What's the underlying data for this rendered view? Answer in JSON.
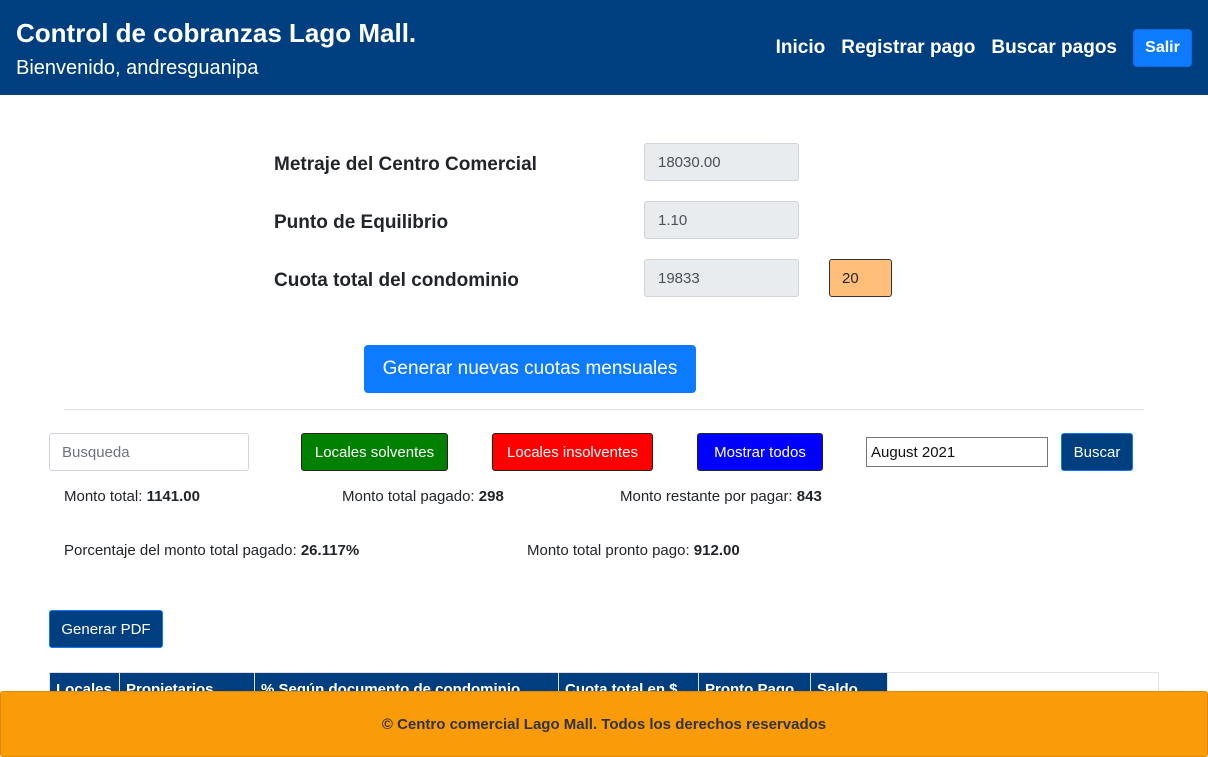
{
  "header": {
    "title": "Control de cobranzas Lago Mall.",
    "welcome": "Bienvenido, andresguanipa",
    "nav": {
      "inicio": "Inicio",
      "registrar": "Registrar pago",
      "buscar": "Buscar pagos",
      "salir": "Salir"
    }
  },
  "form": {
    "metraje": {
      "label": "Metraje del Centro Comercial",
      "value": "18030.00"
    },
    "equilibrio": {
      "label": "Punto de Equilibrio",
      "value": "1.10"
    },
    "cuota": {
      "label": "Cuota total del condominio",
      "value": "19833",
      "extra_value": "20"
    },
    "generate_button": "Generar nuevas cuotas mensuales"
  },
  "filters": {
    "search_placeholder": "Busqueda",
    "solventes": "Locales solventes",
    "insolventes": "Locales insolventes",
    "todos": "Mostrar todos",
    "month_value": "August 2021",
    "buscar": "Buscar",
    "colors": {
      "solventes": "#008000",
      "insolventes": "#ff0000",
      "todos": "#0000ff"
    }
  },
  "stats": {
    "monto_total": {
      "label": "Monto total:",
      "value": "1141.00"
    },
    "monto_pagado": {
      "label": "Monto total pagado:",
      "value": "298"
    },
    "monto_restante": {
      "label": "Monto restante por pagar:",
      "value": "843"
    },
    "porcentaje": {
      "label": "Porcentaje del monto total pagado:",
      "value": "26.117%"
    },
    "pronto_pago": {
      "label": "Monto total pronto pago:",
      "value": "912.00"
    }
  },
  "pdf_button": "Generar PDF",
  "table": {
    "columns": [
      "Locales",
      "Propietarios",
      "% Según documento de condominio",
      "Cuota total en $",
      "Pronto Pago",
      "Saldo"
    ]
  },
  "footer": "© Centro comercial Lago Mall. Todos los derechos reservados",
  "colors": {
    "primary_dark": "#003f7f",
    "primary": "#0d7bff",
    "footer": "#fa9b0a",
    "highlight": "#ffbf7a"
  }
}
